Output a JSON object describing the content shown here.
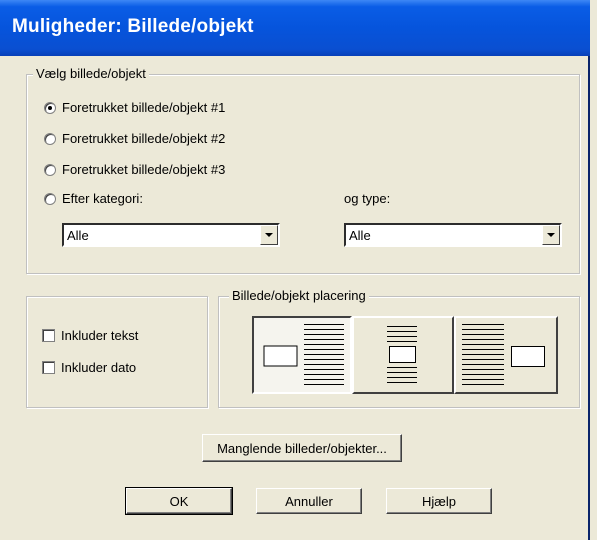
{
  "dialog": {
    "title": "Muligheder: Billede/objekt"
  },
  "select_group": {
    "legend": "Vælg billede/objekt",
    "options": [
      {
        "label": "Foretrukket billede/objekt #1",
        "checked": true
      },
      {
        "label": "Foretrukket billede/objekt #2",
        "checked": false
      },
      {
        "label": "Foretrukket billede/objekt #3",
        "checked": false
      },
      {
        "label": "Efter kategori:",
        "checked": false
      }
    ],
    "type_label": "og type:",
    "category_value": "Alle",
    "type_value": "Alle"
  },
  "include": {
    "text_label": "Inkluder tekst",
    "date_label": "Inkluder dato",
    "text_checked": false,
    "date_checked": false
  },
  "placement": {
    "legend": "Billede/objekt placering",
    "options": [
      "left",
      "top",
      "right"
    ],
    "selected": "left"
  },
  "buttons": {
    "missing": "Manglende billeder/objekter...",
    "ok": "OK",
    "cancel": "Annuller",
    "help": "Hjælp"
  }
}
